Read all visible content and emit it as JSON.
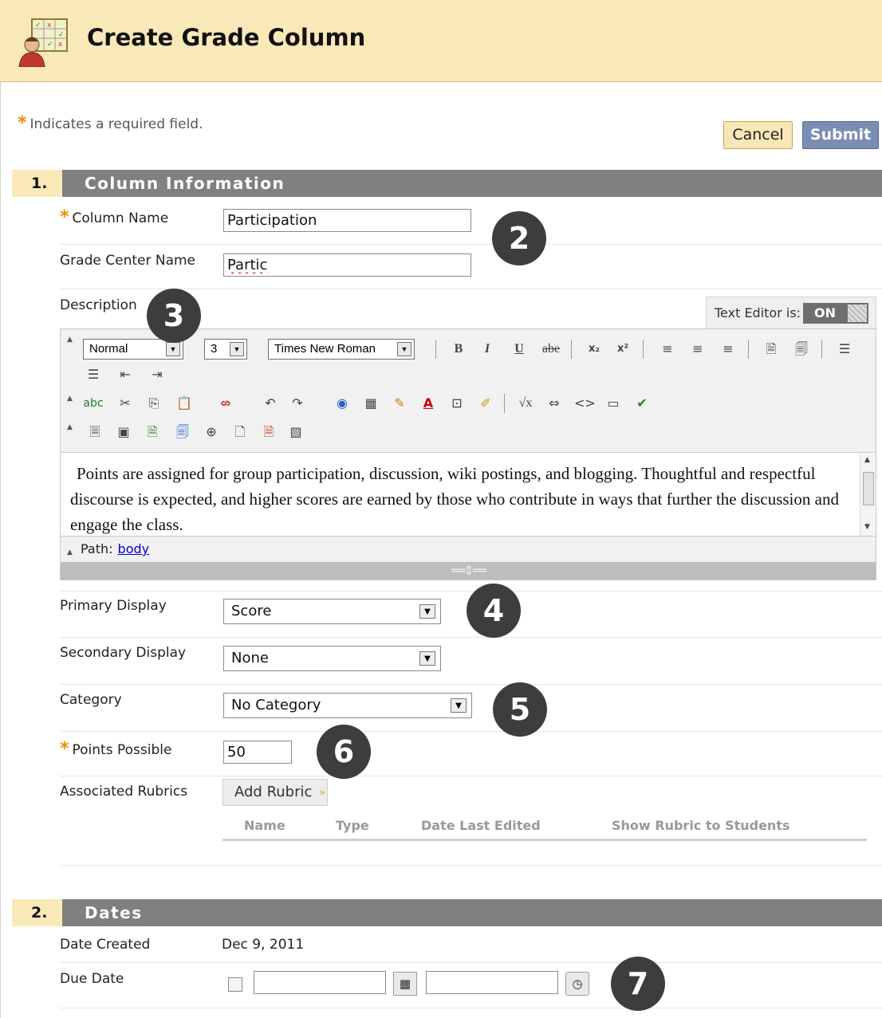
{
  "header": {
    "title": "Create Grade Column",
    "icon": "gradebook-teacher-icon"
  },
  "required_note": "Indicates a required field.",
  "actions": {
    "cancel_label": "Cancel",
    "submit_label": "Submit"
  },
  "section1": {
    "number": "1.",
    "title": "Column Information",
    "column_name": {
      "label": "Column Name",
      "value": "Participation",
      "required": true
    },
    "grade_center_name": {
      "label": "Grade Center Name",
      "value": "Partic"
    },
    "description": {
      "label": "Description",
      "text_editor_label": "Text Editor is:",
      "text_editor_state": "ON",
      "toolbar": {
        "format": "Normal",
        "size": "3",
        "font": "Times New Roman"
      },
      "content": "Points are assigned for group participation, discussion, wiki postings, and blogging. Thoughtful and respectful discourse is expected, and higher scores are earned by those who contribute in ways that further the discussion and engage the class.",
      "path_label": "Path:",
      "path_link": "body"
    },
    "primary_display": {
      "label": "Primary Display",
      "value": "Score"
    },
    "secondary_display": {
      "label": "Secondary Display",
      "value": "None"
    },
    "category": {
      "label": "Category",
      "value": "No Category"
    },
    "points_possible": {
      "label": "Points Possible",
      "value": "50",
      "required": true
    },
    "rubrics": {
      "label": "Associated Rubrics",
      "add_button": "Add Rubric",
      "columns": [
        "Name",
        "Type",
        "Date Last Edited",
        "Show Rubric to Students"
      ]
    }
  },
  "section2": {
    "number": "2.",
    "title": "Dates",
    "date_created": {
      "label": "Date Created",
      "value": "Dec 9, 2011"
    },
    "due_date": {
      "label": "Due Date",
      "date_value": "",
      "time_value": ""
    }
  },
  "callouts": [
    "2",
    "3",
    "4",
    "5",
    "6",
    "7"
  ],
  "colors": {
    "header_bg": "#f9e9b8",
    "section_bar": "#808080",
    "required_star": "#f08a00",
    "submit_bg": "#7c8db3",
    "callout_bg": "#3d3d3d"
  }
}
